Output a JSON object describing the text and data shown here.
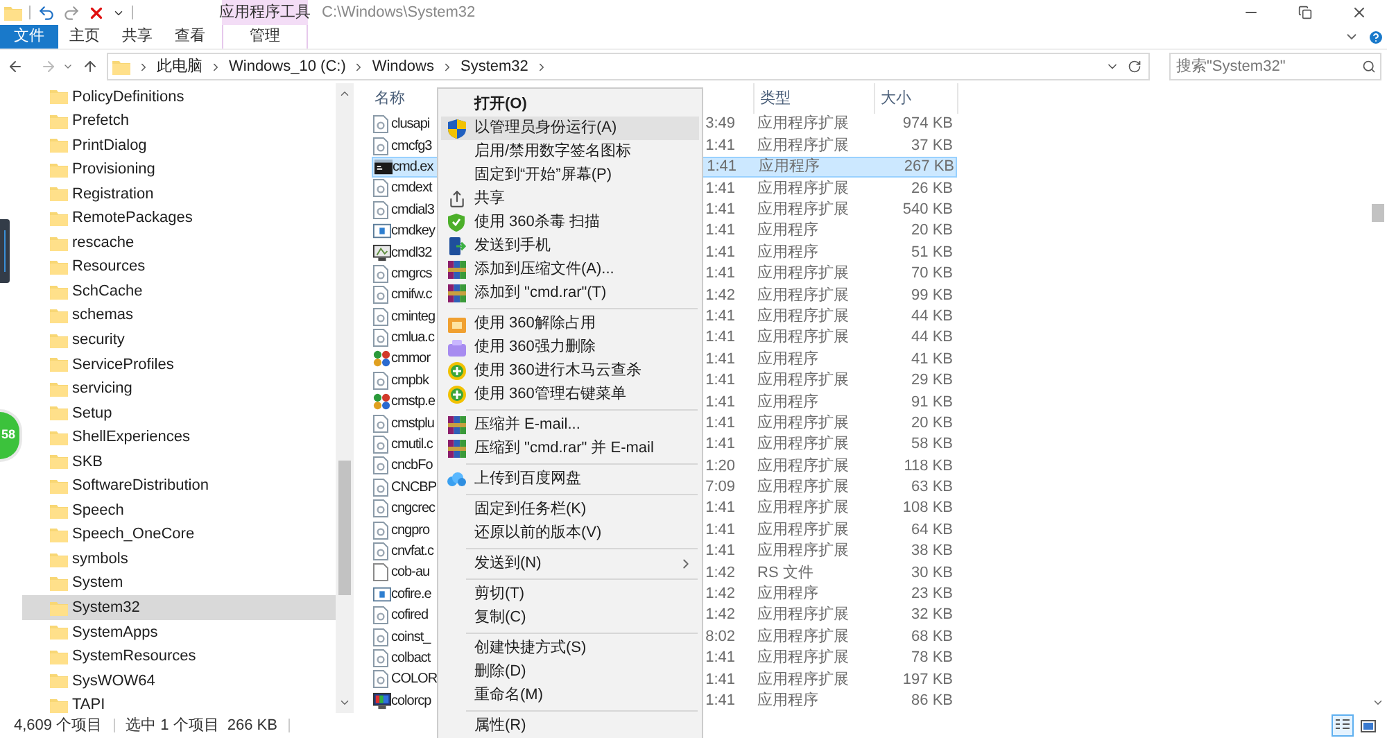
{
  "ribbon": {
    "context_group": "应用程序工具",
    "title": "C:\\Windows\\System32",
    "tabs": [
      {
        "label": "文件",
        "kind": "file"
      },
      {
        "label": "主页",
        "kind": "normal"
      },
      {
        "label": "共享",
        "kind": "normal"
      },
      {
        "label": "查看",
        "kind": "normal"
      },
      {
        "label": "管理",
        "kind": "context"
      }
    ]
  },
  "address_bar": {
    "crumbs": [
      "此电脑",
      "Windows_10 (C:)",
      "Windows",
      "System32"
    ]
  },
  "search": {
    "placeholder": "搜索\"System32\""
  },
  "nav_pane": {
    "items": [
      {
        "label": "PolicyDefinitions",
        "selected": false
      },
      {
        "label": "Prefetch",
        "selected": false
      },
      {
        "label": "PrintDialog",
        "selected": false
      },
      {
        "label": "Provisioning",
        "selected": false
      },
      {
        "label": "Registration",
        "selected": false
      },
      {
        "label": "RemotePackages",
        "selected": false
      },
      {
        "label": "rescache",
        "selected": false
      },
      {
        "label": "Resources",
        "selected": false
      },
      {
        "label": "SchCache",
        "selected": false
      },
      {
        "label": "schemas",
        "selected": false
      },
      {
        "label": "security",
        "selected": false
      },
      {
        "label": "ServiceProfiles",
        "selected": false
      },
      {
        "label": "servicing",
        "selected": false
      },
      {
        "label": "Setup",
        "selected": false
      },
      {
        "label": "ShellExperiences",
        "selected": false
      },
      {
        "label": "SKB",
        "selected": false
      },
      {
        "label": "SoftwareDistribution",
        "selected": false
      },
      {
        "label": "Speech",
        "selected": false
      },
      {
        "label": "Speech_OneCore",
        "selected": false
      },
      {
        "label": "symbols",
        "selected": false
      },
      {
        "label": "System",
        "selected": false
      },
      {
        "label": "System32",
        "selected": true
      },
      {
        "label": "SystemApps",
        "selected": false
      },
      {
        "label": "SystemResources",
        "selected": false
      },
      {
        "label": "SysWOW64",
        "selected": false
      },
      {
        "label": "TAPI",
        "selected": false
      }
    ]
  },
  "file_list": {
    "columns": [
      "名称",
      "类型",
      "大小"
    ],
    "rows": [
      {
        "name": "clusapi",
        "kind": "dll",
        "time": "3:49",
        "type": "应用程序扩展",
        "size": "974 KB",
        "selected": false
      },
      {
        "name": "cmcfg3",
        "kind": "dll",
        "time": "1:41",
        "type": "应用程序扩展",
        "size": "37 KB",
        "selected": false
      },
      {
        "name": "cmd.ex",
        "kind": "console",
        "time": "1:41",
        "type": "应用程序",
        "size": "267 KB",
        "selected": true
      },
      {
        "name": "cmdext",
        "kind": "dll",
        "time": "1:41",
        "type": "应用程序扩展",
        "size": "26 KB",
        "selected": false
      },
      {
        "name": "cmdial3",
        "kind": "dll",
        "time": "1:41",
        "type": "应用程序扩展",
        "size": "540 KB",
        "selected": false
      },
      {
        "name": "cmdkey",
        "kind": "window",
        "time": "1:41",
        "type": "应用程序",
        "size": "20 KB",
        "selected": false
      },
      {
        "name": "cmdl32",
        "kind": "app",
        "time": "1:41",
        "type": "应用程序",
        "size": "51 KB",
        "selected": false
      },
      {
        "name": "cmgrcs",
        "kind": "dll",
        "time": "1:41",
        "type": "应用程序扩展",
        "size": "70 KB",
        "selected": false
      },
      {
        "name": "cmifw.c",
        "kind": "dll",
        "time": "1:42",
        "type": "应用程序扩展",
        "size": "99 KB",
        "selected": false
      },
      {
        "name": "cminteg",
        "kind": "dll",
        "time": "1:41",
        "type": "应用程序扩展",
        "size": "44 KB",
        "selected": false
      },
      {
        "name": "cmlua.c",
        "kind": "dll",
        "time": "1:41",
        "type": "应用程序扩展",
        "size": "44 KB",
        "selected": false
      },
      {
        "name": "cmmor",
        "kind": "colorful",
        "time": "1:41",
        "type": "应用程序",
        "size": "41 KB",
        "selected": false
      },
      {
        "name": "cmpbk",
        "kind": "dll",
        "time": "1:41",
        "type": "应用程序扩展",
        "size": "29 KB",
        "selected": false
      },
      {
        "name": "cmstp.e",
        "kind": "colorful",
        "time": "1:41",
        "type": "应用程序",
        "size": "91 KB",
        "selected": false
      },
      {
        "name": "cmstplu",
        "kind": "dll",
        "time": "1:41",
        "type": "应用程序扩展",
        "size": "20 KB",
        "selected": false
      },
      {
        "name": "cmutil.c",
        "kind": "dll",
        "time": "1:41",
        "type": "应用程序扩展",
        "size": "58 KB",
        "selected": false
      },
      {
        "name": "cncbFo",
        "kind": "dll",
        "time": "1:20",
        "type": "应用程序扩展",
        "size": "118 KB",
        "selected": false
      },
      {
        "name": "CNCBP",
        "kind": "dll",
        "time": "7:09",
        "type": "应用程序扩展",
        "size": "63 KB",
        "selected": false
      },
      {
        "name": "cngcrec",
        "kind": "dll",
        "time": "1:41",
        "type": "应用程序扩展",
        "size": "108 KB",
        "selected": false
      },
      {
        "name": "cngpro",
        "kind": "dll",
        "time": "1:41",
        "type": "应用程序扩展",
        "size": "64 KB",
        "selected": false
      },
      {
        "name": "cnvfat.c",
        "kind": "dll",
        "time": "1:41",
        "type": "应用程序扩展",
        "size": "38 KB",
        "selected": false
      },
      {
        "name": "cob-au",
        "kind": "blank",
        "time": "1:42",
        "type": "RS 文件",
        "size": "30 KB",
        "selected": false
      },
      {
        "name": "cofire.e",
        "kind": "window",
        "time": "1:42",
        "type": "应用程序",
        "size": "23 KB",
        "selected": false
      },
      {
        "name": "cofired",
        "kind": "dll",
        "time": "1:42",
        "type": "应用程序扩展",
        "size": "32 KB",
        "selected": false
      },
      {
        "name": "coinst_",
        "kind": "dll",
        "time": "8:02",
        "type": "应用程序扩展",
        "size": "68 KB",
        "selected": false
      },
      {
        "name": "colbact",
        "kind": "dll",
        "time": "1:41",
        "type": "应用程序扩展",
        "size": "78 KB",
        "selected": false
      },
      {
        "name": "COLOR",
        "kind": "dll",
        "time": "1:41",
        "type": "应用程序扩展",
        "size": "197 KB",
        "selected": false
      },
      {
        "name": "colorcp",
        "kind": "monitor",
        "time": "1:41",
        "type": "应用程序",
        "size": "86 KB",
        "selected": false
      }
    ]
  },
  "context_menu": {
    "items": [
      {
        "kind": "item",
        "label": "打开(O)",
        "bold": true,
        "selected": false
      },
      {
        "kind": "item",
        "label": "以管理员身份运行(A)",
        "bold": false,
        "selected": true
      },
      {
        "kind": "item",
        "label": "启用/禁用数字签名图标",
        "bold": false,
        "selected": false
      },
      {
        "kind": "item",
        "label": "固定到“开始”屏幕(P)",
        "bold": false,
        "selected": false
      },
      {
        "kind": "item",
        "label": "共享",
        "bold": false,
        "selected": false
      },
      {
        "kind": "item",
        "label": "使用 360杀毒 扫描",
        "bold": false,
        "selected": false
      },
      {
        "kind": "item",
        "label": "发送到手机",
        "bold": false,
        "selected": false
      },
      {
        "kind": "item",
        "label": "添加到压缩文件(A)...",
        "bold": false,
        "selected": false
      },
      {
        "kind": "item",
        "label": "添加到 \"cmd.rar\"(T)",
        "bold": false,
        "selected": false
      },
      {
        "kind": "separator"
      },
      {
        "kind": "item",
        "label": "使用 360解除占用",
        "bold": false,
        "selected": false
      },
      {
        "kind": "item",
        "label": "使用 360强力删除",
        "bold": false,
        "selected": false
      },
      {
        "kind": "item",
        "label": "使用 360进行木马云查杀",
        "bold": false,
        "selected": false
      },
      {
        "kind": "item",
        "label": "使用 360管理右键菜单",
        "bold": false,
        "selected": false
      },
      {
        "kind": "separator"
      },
      {
        "kind": "item",
        "label": "压缩并 E-mail...",
        "bold": false,
        "selected": false
      },
      {
        "kind": "item",
        "label": "压缩到 \"cmd.rar\" 并 E-mail",
        "bold": false,
        "selected": false
      },
      {
        "kind": "separator"
      },
      {
        "kind": "item",
        "label": "上传到百度网盘",
        "bold": false,
        "selected": false
      },
      {
        "kind": "separator"
      },
      {
        "kind": "item",
        "label": "固定到任务栏(K)",
        "bold": false,
        "selected": false
      },
      {
        "kind": "item",
        "label": "还原以前的版本(V)",
        "bold": false,
        "selected": false
      },
      {
        "kind": "separator"
      },
      {
        "kind": "submenu",
        "label": "发送到(N)",
        "bold": false,
        "selected": false
      },
      {
        "kind": "separator"
      },
      {
        "kind": "item",
        "label": "剪切(T)",
        "bold": false,
        "selected": false
      },
      {
        "kind": "item",
        "label": "复制(C)",
        "bold": false,
        "selected": false
      },
      {
        "kind": "separator"
      },
      {
        "kind": "item",
        "label": "创建快捷方式(S)",
        "bold": false,
        "selected": false
      },
      {
        "kind": "item",
        "label": "删除(D)",
        "bold": false,
        "selected": false
      },
      {
        "kind": "item",
        "label": "重命名(M)",
        "bold": false,
        "selected": false
      },
      {
        "kind": "separator"
      },
      {
        "kind": "item",
        "label": "属性(R)",
        "bold": false,
        "selected": false
      }
    ]
  },
  "status_bar": {
    "item_count": "4,609 个项目",
    "selection": "选中 1 个项目",
    "selection_size": "266 KB",
    "views": [
      {
        "kind": "details",
        "selected": true
      },
      {
        "kind": "thumbnails",
        "selected": false
      }
    ]
  },
  "floating_badge": {
    "label": "58"
  }
}
